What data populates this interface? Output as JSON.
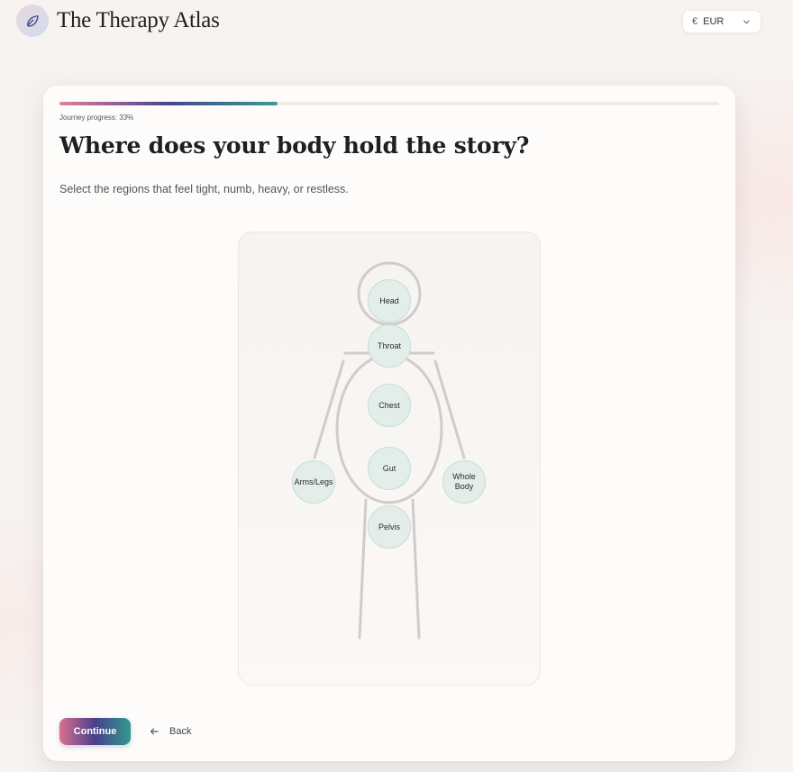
{
  "header": {
    "brand_title": "The Therapy Atlas",
    "brand_icon": "leaf-icon",
    "currency": {
      "symbol": "€",
      "code": "EUR"
    }
  },
  "progress": {
    "label": "Journey progress: 33%",
    "value_percent": 33
  },
  "question": {
    "title": "Where does your body hold the story?",
    "subtitle": "Select the regions that feel tight, numb, heavy, or restless."
  },
  "regions": {
    "head": "Head",
    "throat": "Throat",
    "chest": "Chest",
    "gut": "Gut",
    "arms_legs": "Arms/Legs",
    "whole_body_line1": "Whole",
    "whole_body_line2": "Body",
    "pelvis": "Pelvis"
  },
  "actions": {
    "continue": "Continue",
    "back": "Back"
  },
  "colors": {
    "accent_pink": "#e2809a",
    "accent_indigo": "#43468d",
    "accent_teal": "#3a9c8f",
    "region_fill": "#e3eeea"
  }
}
